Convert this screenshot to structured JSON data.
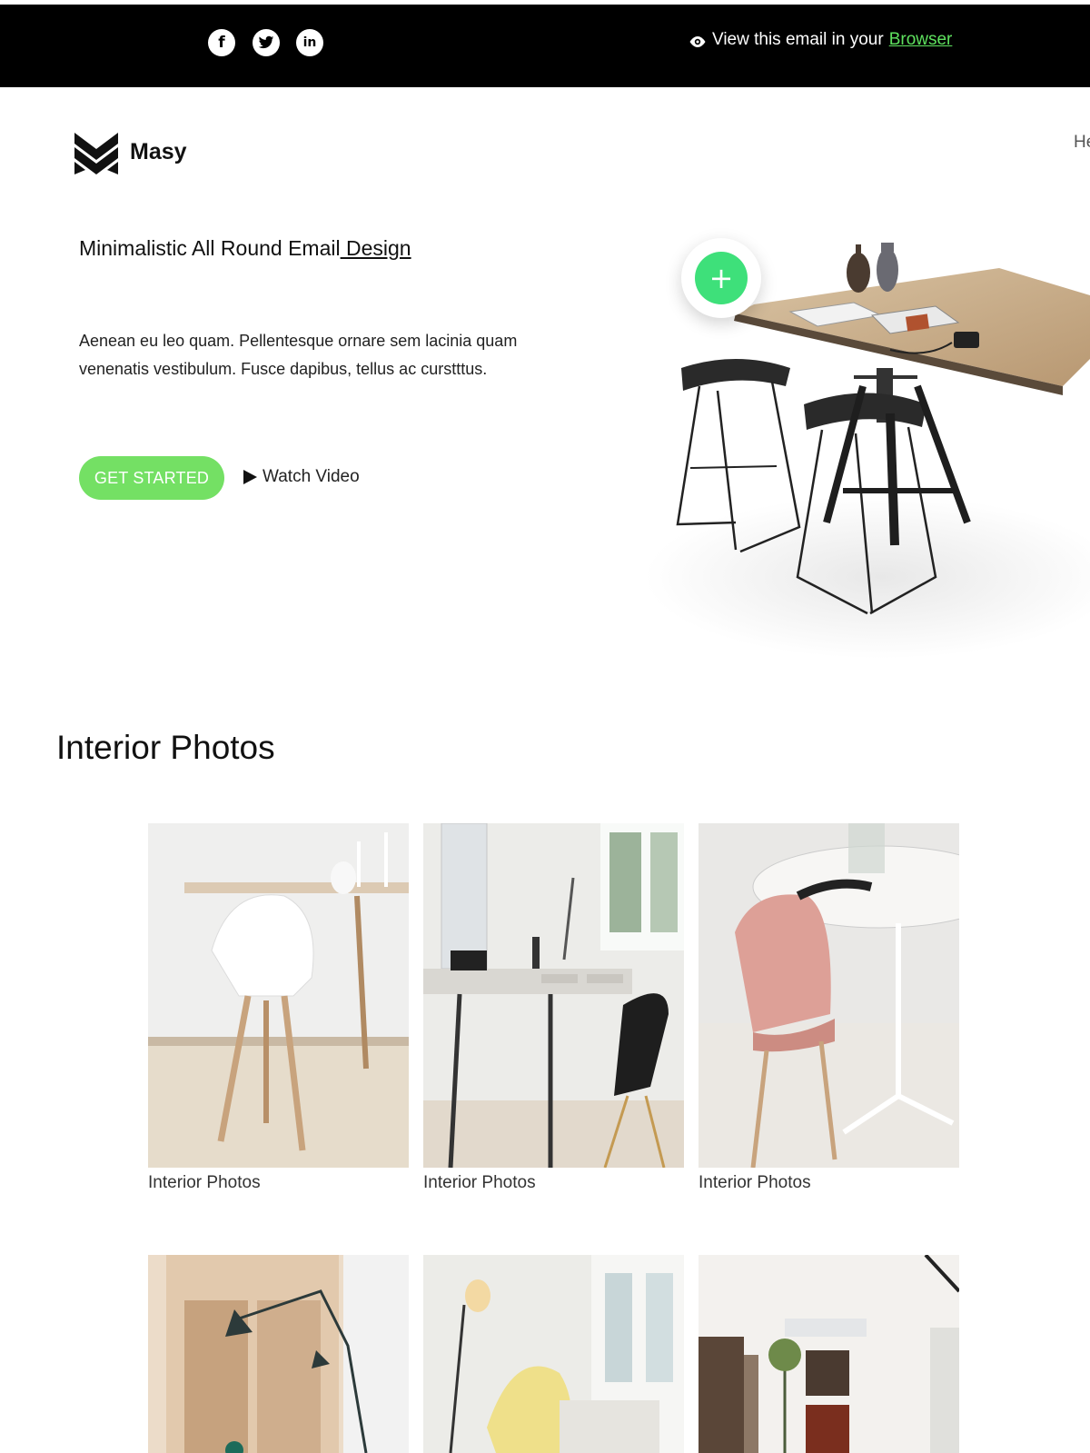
{
  "topbar": {
    "social": [
      {
        "name": "facebook",
        "glyph": "f"
      },
      {
        "name": "twitter",
        "glyph": "t"
      },
      {
        "name": "linkedin",
        "glyph": "in"
      }
    ],
    "view_text": "View this email in your",
    "view_link": "Browser",
    "link_color": "#5ee15e"
  },
  "header": {
    "brand": "Masy",
    "nav_peek": "He"
  },
  "hero": {
    "title_main": "Minimalistic All Round Email",
    "title_link": " Design",
    "description": "Aenean eu leo quam. Pellentesque ornare sem lacinia quam venenatis vestibulum. Fusce dapibus, tellus ac curstttus.",
    "cta_label": "GET STARTED",
    "cta_color": "#74e064",
    "watch_label": "Watch Video",
    "plus_label": "+",
    "plus_color": "#3ee07a"
  },
  "gallery": {
    "title": "Interior Photos",
    "items": [
      {
        "caption": "Interior Photos"
      },
      {
        "caption": "Interior Photos"
      },
      {
        "caption": "Interior Photos"
      },
      {
        "caption": ""
      },
      {
        "caption": ""
      },
      {
        "caption": ""
      }
    ]
  }
}
